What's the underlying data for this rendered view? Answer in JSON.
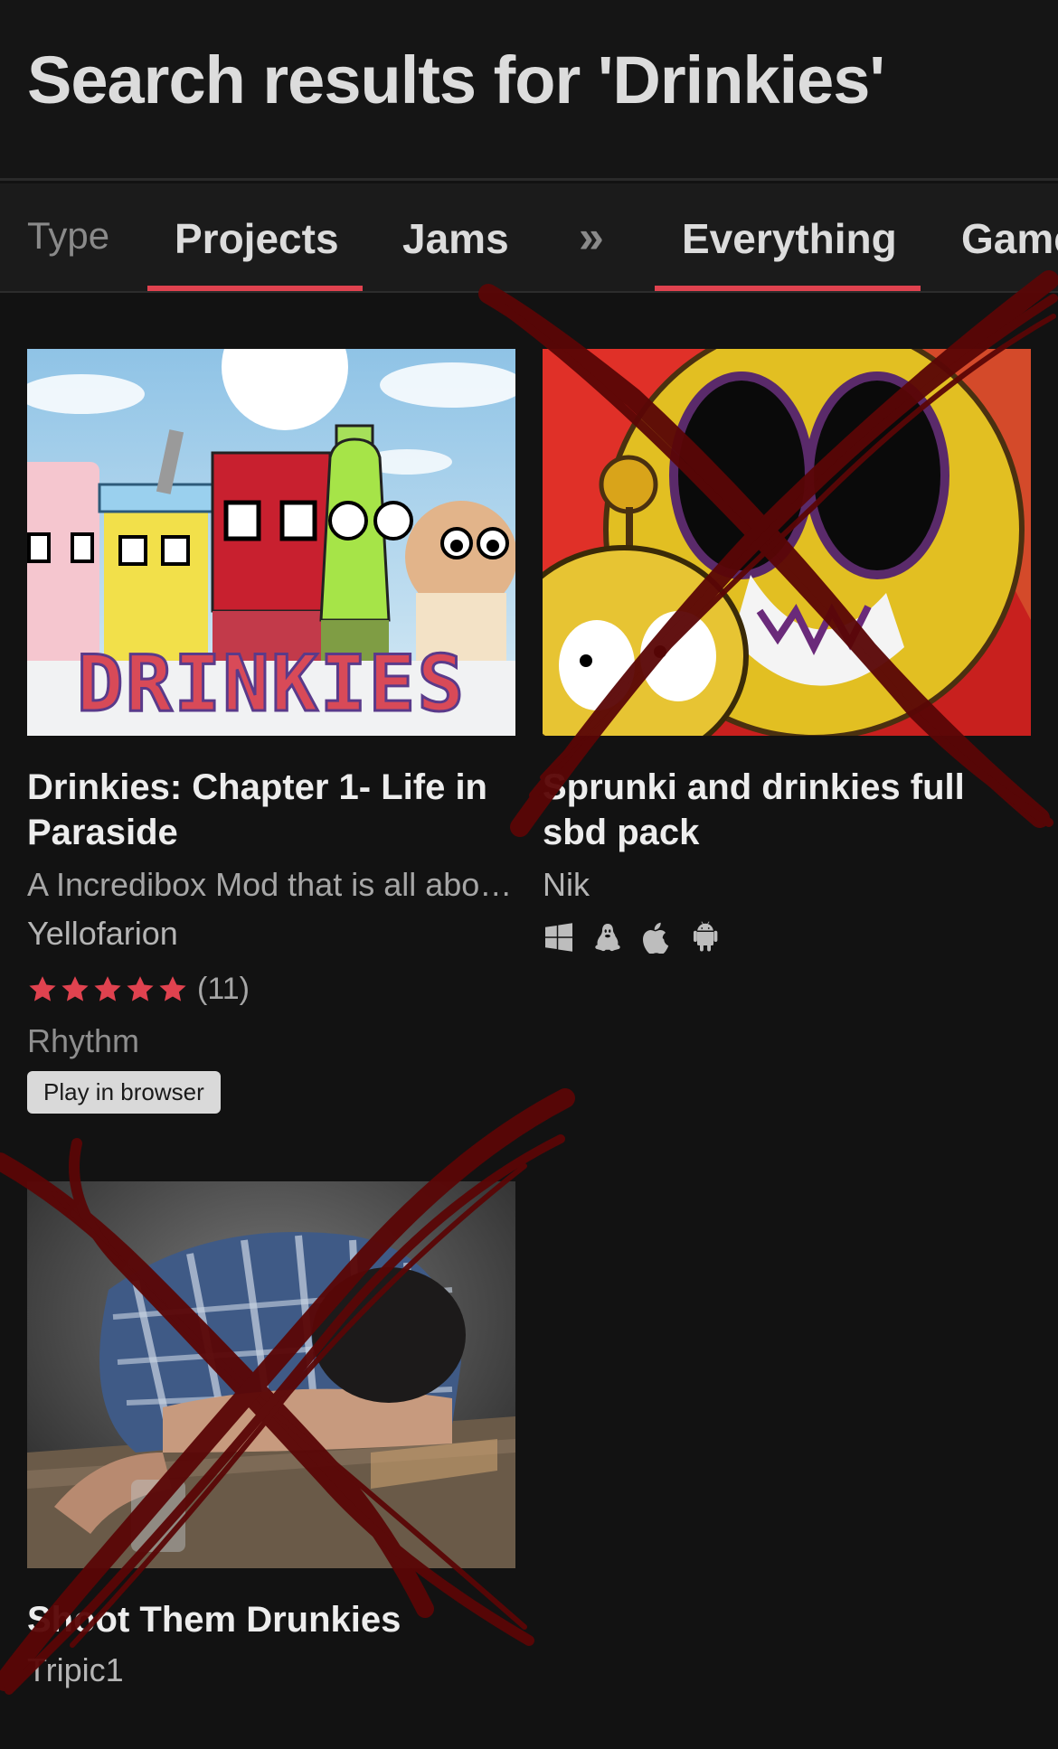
{
  "header": {
    "title": "Search results for 'Drinkies'"
  },
  "filters": {
    "type_label": "Type",
    "tabs": [
      {
        "label": "Projects",
        "active": true
      },
      {
        "label": "Jams",
        "active": false
      }
    ],
    "more_icon": "double-chevron-icon",
    "scope_tabs": [
      {
        "label": "Everything",
        "active": true
      },
      {
        "label": "Games",
        "active": false
      }
    ]
  },
  "results": [
    {
      "title": "Drinkies: Chapter 1- Life in Paraside",
      "description": "A Incredibox Mod that is all abo…",
      "author": "Yellofarion",
      "rating": {
        "stars": 5,
        "count": "(11)"
      },
      "genre": "Rhythm",
      "button": "Play in browser",
      "thumbnail_text": "DRINKIES",
      "crossed_out": false
    },
    {
      "title": "Sprunki and drinkies full sbd pack",
      "author": "Nik",
      "platforms": [
        "windows-icon",
        "linux-icon",
        "apple-icon",
        "android-icon"
      ],
      "crossed_out": true
    },
    {
      "title": "Shoot Them Drunkies",
      "author": "Tripic1",
      "crossed_out": true
    }
  ],
  "colors": {
    "accent": "#e0424f",
    "background": "#121212",
    "scribble": "#5a0606"
  }
}
